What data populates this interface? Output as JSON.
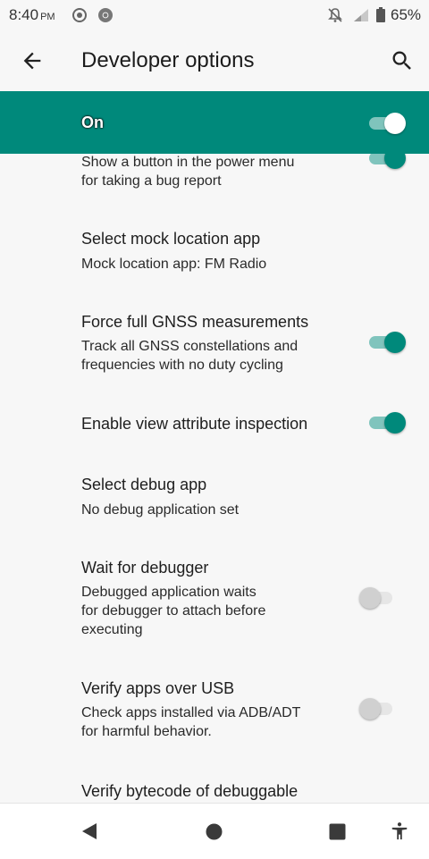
{
  "status_bar": {
    "time": "8:40",
    "ampm": "PM",
    "battery_percent": "65%",
    "icons": [
      "location-icon",
      "chrome-icon",
      "notifications-off-icon",
      "signal-icon",
      "battery-icon"
    ]
  },
  "app_bar": {
    "title": "Developer options",
    "back_icon": "arrow-back-icon",
    "search_icon": "search-icon"
  },
  "master_switch": {
    "label": "On",
    "checked": true
  },
  "items": [
    {
      "title": "",
      "summary": "Show a button in the power menu\nfor taking a bug report",
      "toggle": true,
      "checked": true
    },
    {
      "title": "Select mock location app",
      "summary": "Mock location app: FM Radio",
      "toggle": false
    },
    {
      "title": "Force full GNSS measurements",
      "summary": "Track all GNSS constellations and\nfrequencies with no duty cycling",
      "toggle": true,
      "checked": true
    },
    {
      "title": "Enable view attribute inspection",
      "summary": "",
      "toggle": true,
      "checked": true
    },
    {
      "title": "Select debug app",
      "summary": "No debug application set",
      "toggle": false
    },
    {
      "title": "Wait for debugger",
      "summary": "Debugged application waits\nfor debugger to attach before\nexecuting",
      "toggle": true,
      "checked": false
    },
    {
      "title": "Verify apps over USB",
      "summary": "Check apps installed via ADB/ADT\nfor harmful behavior.",
      "toggle": true,
      "checked": false
    },
    {
      "title": "Verify bytecode of debuggable",
      "summary": "",
      "toggle": false
    }
  ],
  "nav_bar": {
    "buttons": [
      "back-triangle-icon",
      "home-circle-icon",
      "recents-square-icon",
      "accessibility-icon"
    ]
  },
  "colors": {
    "accent": "#00897b",
    "accent_track": "#80c4bd",
    "background": "#f7f7f7"
  }
}
